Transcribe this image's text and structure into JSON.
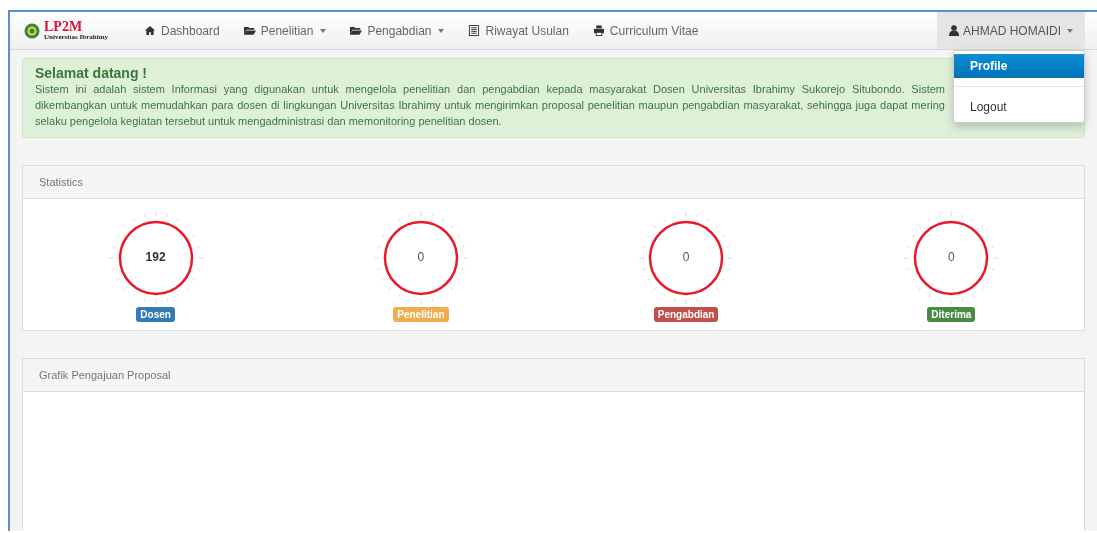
{
  "brand": {
    "title": "LP2M",
    "subtitle": "Universitas Ibrahimy"
  },
  "nav": [
    {
      "label": "Dashboard",
      "dropdown": false
    },
    {
      "label": "Penelitian",
      "dropdown": true
    },
    {
      "label": "Pengabdian",
      "dropdown": true
    },
    {
      "label": "Riwayat Usulan",
      "dropdown": false
    },
    {
      "label": "Curriculum Vitae",
      "dropdown": false
    }
  ],
  "user_menu": {
    "label": "AHMAD HOMAIDI",
    "open": true,
    "items": [
      {
        "label": "Profile",
        "selected": true
      },
      {
        "label": "Logout",
        "selected": false
      }
    ]
  },
  "alert": {
    "title": "Selamat datang !",
    "text": "Sistem ini adalah sistem Informasi yang digunakan untuk mengelola penelitian dan pengabdian kepada masyarakat Dosen Universitas Ibrahimy Sukorejo Situbondo. Sistem dikembangkan untuk memudahkan para dosen di lingkungan Universitas Ibrahimy untuk mengirimkan proposal penelitian maupun pengabdian masyarakat, sehingga juga dapat mering selaku pengelola kegiatan tersebut untuk mengadministrasi dan memonitoring penelitian dosen."
  },
  "statistics": {
    "title": "Statistics",
    "gauges": [
      {
        "value": "192",
        "label": "Dosen",
        "color": "#337ab7"
      },
      {
        "value": "0",
        "label": "Penelitian",
        "color": "#f0ad4e"
      },
      {
        "value": "0",
        "label": "Pengabdian",
        "color": "#c0504d"
      },
      {
        "value": "0",
        "label": "Diterima",
        "color": "#4a8b44"
      }
    ]
  },
  "chart_panel": {
    "title": "Grafik Pengajuan Proposal"
  }
}
